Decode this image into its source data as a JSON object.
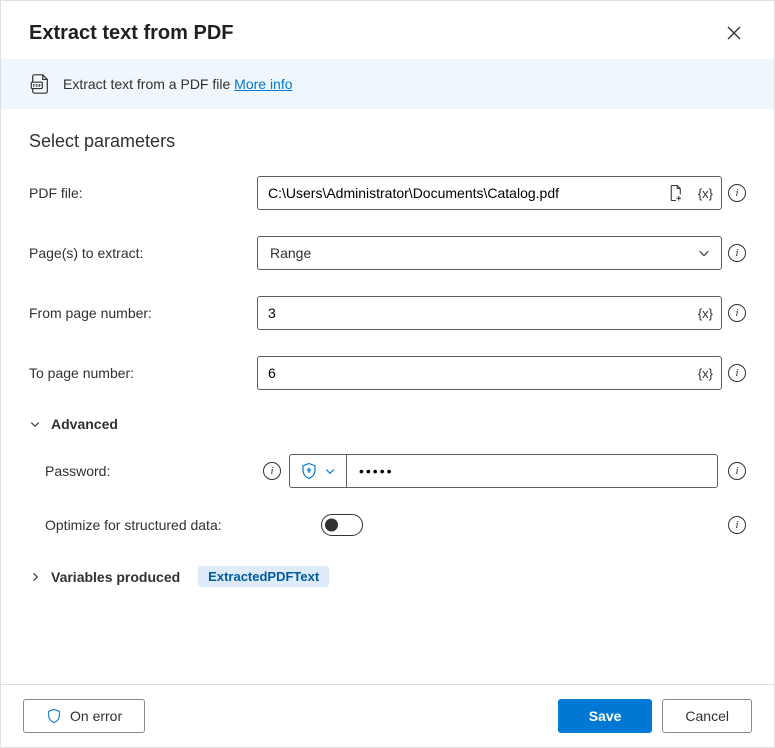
{
  "header": {
    "title": "Extract text from PDF"
  },
  "banner": {
    "text": "Extract text from a PDF file ",
    "link": "More info"
  },
  "section_title": "Select parameters",
  "fields": {
    "pdf_file": {
      "label": "PDF file:",
      "value": "C:\\Users\\Administrator\\Documents\\Catalog.pdf"
    },
    "pages": {
      "label": "Page(s) to extract:",
      "value": "Range"
    },
    "from_page": {
      "label": "From page number:",
      "value": "3"
    },
    "to_page": {
      "label": "To page number:",
      "value": "6"
    }
  },
  "advanced": {
    "heading": "Advanced",
    "password": {
      "label": "Password:",
      "value": "•••••"
    },
    "optimize": {
      "label": "Optimize for structured data:",
      "value": false
    }
  },
  "variables": {
    "label": "Variables produced",
    "produced": "ExtractedPDFText"
  },
  "footer": {
    "on_error": "On error",
    "save": "Save",
    "cancel": "Cancel"
  },
  "tokens": {
    "var": "{x}"
  }
}
